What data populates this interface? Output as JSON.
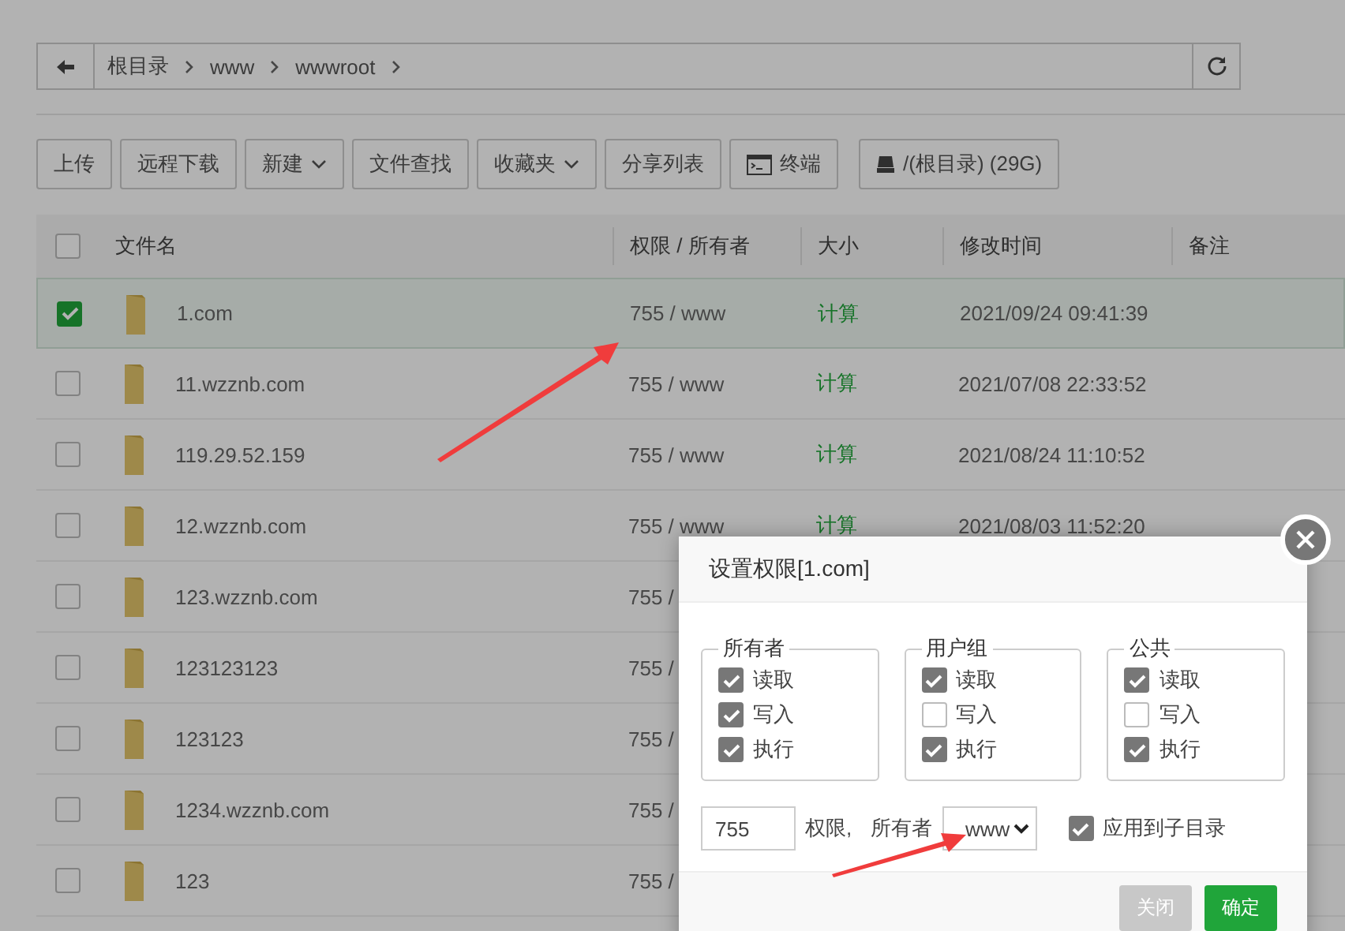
{
  "breadcrumb": {
    "items": [
      "根目录",
      "www",
      "wwwroot"
    ]
  },
  "toolbar": [
    {
      "label": "上传",
      "kind": "plain"
    },
    {
      "label": "远程下载",
      "kind": "plain"
    },
    {
      "label": "新建",
      "kind": "dropdown"
    },
    {
      "label": "文件查找",
      "kind": "plain"
    },
    {
      "label": "收藏夹",
      "kind": "dropdown"
    },
    {
      "label": "分享列表",
      "kind": "plain"
    },
    {
      "label": "终端",
      "kind": "terminal"
    },
    {
      "label": "/(根目录) (29G)",
      "kind": "disk"
    }
  ],
  "table": {
    "columns": [
      "文件名",
      "权限 / 所有者",
      "大小",
      "修改时间",
      "备注"
    ],
    "all_checked": false,
    "rows": [
      {
        "name": "1.com",
        "selected": true,
        "permissions": "755 / www",
        "size": "计算",
        "modified": "2021/09/24 09:41:39"
      },
      {
        "name": "11.wzznb.com",
        "selected": false,
        "permissions": "755 / www",
        "size": "计算",
        "modified": "2021/07/08 22:33:52"
      },
      {
        "name": "119.29.52.159",
        "selected": false,
        "permissions": "755 / www",
        "size": "计算",
        "modified": "2021/08/24 11:10:52"
      },
      {
        "name": "12.wzznb.com",
        "selected": false,
        "permissions": "755 / www",
        "size": "计算",
        "modified": "2021/08/03 11:52:20"
      },
      {
        "name": "123.wzznb.com",
        "selected": false,
        "permissions": "755 /"
      },
      {
        "name": "123123123",
        "selected": false,
        "permissions": "755 /"
      },
      {
        "name": "123123",
        "selected": false,
        "permissions": "755 /"
      },
      {
        "name": "1234.wzznb.com",
        "selected": false,
        "permissions": "755 /"
      },
      {
        "name": "123",
        "selected": false,
        "permissions": "755 /"
      }
    ]
  },
  "dialog": {
    "title": "设置权限[1.com]",
    "groups": [
      {
        "label": "所有者",
        "options": [
          {
            "label": "读取",
            "checked": true
          },
          {
            "label": "写入",
            "checked": true
          },
          {
            "label": "执行",
            "checked": true
          }
        ]
      },
      {
        "label": "用户组",
        "options": [
          {
            "label": "读取",
            "checked": true
          },
          {
            "label": "写入",
            "checked": false
          },
          {
            "label": "执行",
            "checked": true
          }
        ]
      },
      {
        "label": "公共",
        "options": [
          {
            "label": "读取",
            "checked": true
          },
          {
            "label": "写入",
            "checked": false
          },
          {
            "label": "执行",
            "checked": true
          }
        ]
      }
    ],
    "mode_value": "755",
    "mode_label": "权限,",
    "owner_label": "所有者",
    "owner": "www",
    "apply_subdirs": {
      "label": "应用到子目录",
      "checked": true
    },
    "buttons": [
      {
        "label": "关闭",
        "kind": "secondary"
      },
      {
        "label": "确定",
        "kind": "primary"
      }
    ]
  }
}
